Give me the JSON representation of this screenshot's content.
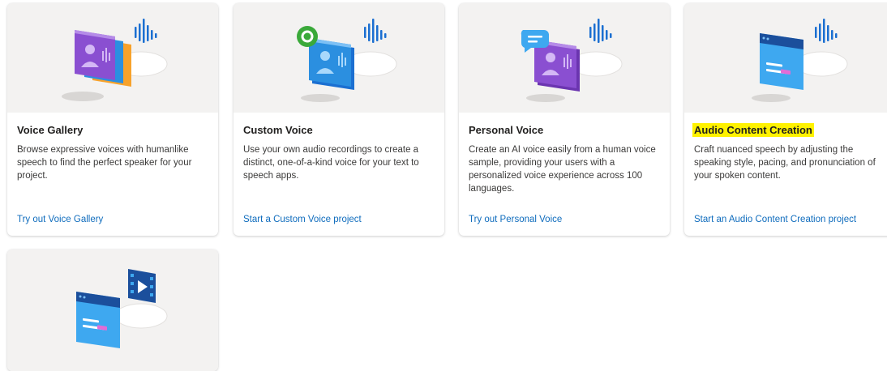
{
  "cards": [
    {
      "title": "Voice Gallery",
      "description": "Browse expressive voices with humanlike speech to find the perfect speaker for your project.",
      "link": "Try out Voice Gallery",
      "art_icon": "voice-gallery-illustration"
    },
    {
      "title": "Custom Voice",
      "description": "Use your own audio recordings to create a distinct, one-of-a-kind voice for your text to speech apps.",
      "link": "Start a Custom Voice project",
      "art_icon": "custom-voice-illustration"
    },
    {
      "title": "Personal Voice",
      "description": "Create an AI voice easily from a human voice sample, providing your users with a personalized voice experience across 100 languages.",
      "link": "Try out Personal Voice",
      "art_icon": "personal-voice-illustration"
    },
    {
      "title": "Audio Content Creation",
      "description": "Craft nuanced speech by adjusting the speaking style, pacing, and pronunciation of your spoken content.",
      "link": "Start an Audio Content Creation project",
      "art_icon": "audio-content-creation-illustration",
      "highlighted": true
    },
    {
      "art_icon": "video-translation-illustration"
    }
  ],
  "colors": {
    "link": "#0f6cbd",
    "highlight": "#fff200",
    "art_background": "#f3f2f1",
    "purple": "#8a4fd1",
    "blue": "#2b8fe0",
    "orange": "#f7a22b",
    "green": "#3aa93a"
  }
}
